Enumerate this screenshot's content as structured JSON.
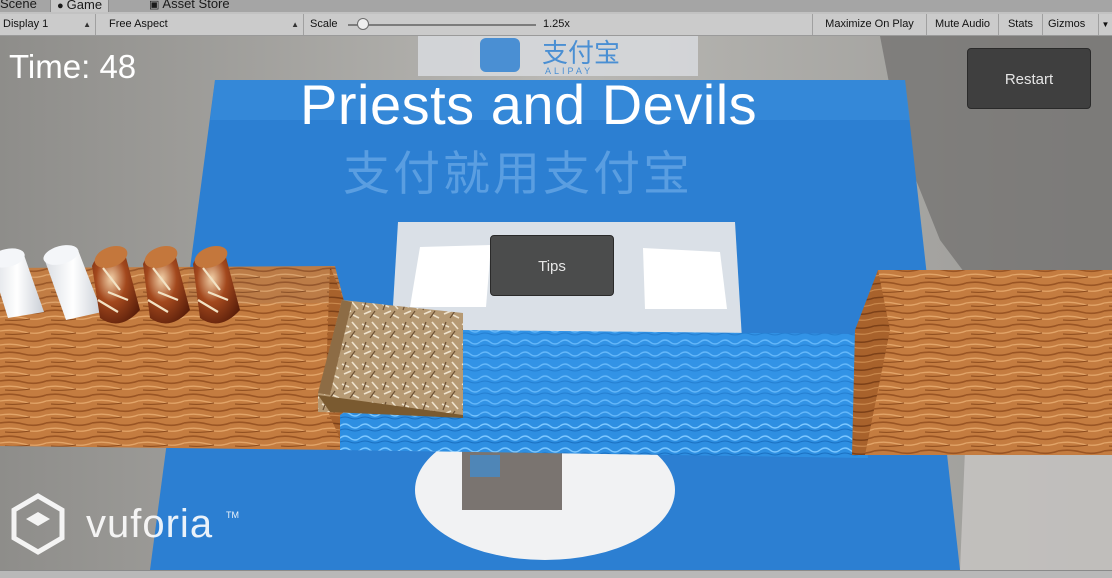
{
  "editor": {
    "tabs": [
      {
        "label": "Scene",
        "icon": "scene-icon"
      },
      {
        "label": "Game",
        "icon": "game-controller-icon"
      },
      {
        "label": "Asset Store",
        "icon": "asset-store-icon"
      }
    ],
    "toolbar": {
      "display": "Display 1",
      "aspect": "Free Aspect",
      "scale_label": "Scale",
      "scale_value": "1.25x",
      "scale_fraction": 0.08,
      "maximize_on_play": "Maximize On Play",
      "mute_audio": "Mute Audio",
      "stats": "Stats",
      "gizmos": "Gizmos"
    }
  },
  "game": {
    "time_text": "Time: 48",
    "title": "Priests and Devils",
    "restart_label": "Restart",
    "tips_label": "Tips",
    "priests_on_left_bank": 2,
    "devils_on_left_bank": 3,
    "boat_side": "left",
    "colors": {
      "water": "#2f8fe0",
      "wood_bank": "#c07a3e",
      "hud_text": "#ffffff",
      "button_bg": "#373737"
    }
  },
  "background": {
    "marker_brand": "支付宝",
    "marker_brand_en": "ALIPAY",
    "marker_slogan": "支付就用支付宝",
    "vuforia_logo": "vuforia"
  }
}
